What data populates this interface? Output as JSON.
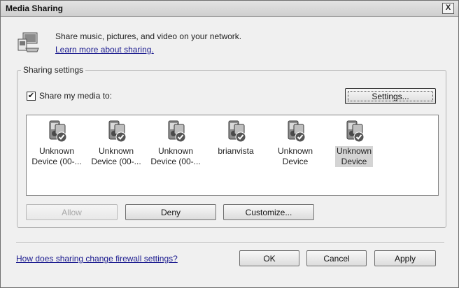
{
  "window": {
    "title": "Media Sharing",
    "close_glyph": "X"
  },
  "header": {
    "description": "Share music, pictures, and video on your network.",
    "learn_more_link": "Learn more about sharing."
  },
  "sharing_settings": {
    "group_label": "Sharing settings",
    "share_checkbox": {
      "label": "Share my media to:",
      "checked": true,
      "glyph": "✔"
    },
    "settings_button": "Settings..."
  },
  "devices": [
    {
      "line1": "Unknown",
      "line2": "Device (00-...",
      "selected": false
    },
    {
      "line1": "Unknown",
      "line2": "Device (00-...",
      "selected": false
    },
    {
      "line1": "Unknown",
      "line2": "Device (00-...",
      "selected": false
    },
    {
      "line1": "brianvista",
      "line2": "",
      "selected": false
    },
    {
      "line1": "Unknown",
      "line2": "Device",
      "selected": false
    },
    {
      "line1": "Unknown",
      "line2": "Device",
      "selected": true
    }
  ],
  "device_actions": {
    "allow": "Allow",
    "deny": "Deny",
    "customize": "Customize..."
  },
  "footer": {
    "firewall_link": "How does sharing change firewall settings?",
    "ok": "OK",
    "cancel": "Cancel",
    "apply": "Apply"
  }
}
